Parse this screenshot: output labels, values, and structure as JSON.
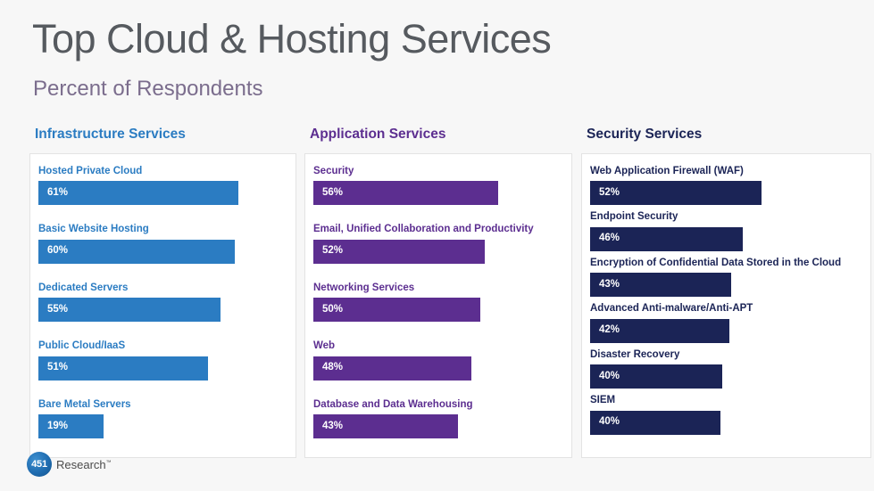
{
  "header": {
    "title": "Top Cloud & Hosting Services",
    "subtitle": "Percent of Respondents"
  },
  "logo": {
    "mark": "451",
    "text": "Research",
    "trademark": "™"
  },
  "colors": {
    "background": "#f7f7f7",
    "panel": "#ffffff",
    "panel_border": "#e3e3e3",
    "title": "#565a5f",
    "subtitle": "#7b6d8d",
    "infrastructure": "#2b7cc2",
    "application": "#5c2e90",
    "security": "#1b2456",
    "value_text": "#ffffff"
  },
  "chart_data": {
    "type": "bar",
    "title": "Top Cloud & Hosting Services",
    "subtitle": "Percent of Respondents",
    "xlabel": "",
    "ylabel": "Percent of Respondents",
    "xlim": [
      0,
      100
    ],
    "grid": false,
    "legend": "none",
    "orientation": "horizontal",
    "value_suffix": "%",
    "groups": [
      {
        "name": "Infrastructure Services",
        "color": "#2b7cc2",
        "categories": [
          "Hosted Private Cloud",
          "Basic Website Hosting",
          "Dedicated Servers",
          "Public Cloud/IaaS",
          "Bare Metal Servers"
        ],
        "values": [
          61,
          60,
          55,
          51,
          19
        ],
        "value_labels": [
          "61%",
          "60%",
          "55%",
          "51%",
          "19%"
        ]
      },
      {
        "name": "Application Services",
        "color": "#5c2e90",
        "categories": [
          "Security",
          "Email, Unified Collaboration and Productivity",
          "Networking Services",
          "Web",
          "Database and Data Warehousing"
        ],
        "values": [
          56,
          52,
          50,
          48,
          43
        ],
        "value_labels": [
          "56%",
          "52%",
          "50%",
          "48%",
          "43%"
        ]
      },
      {
        "name": "Security Services",
        "color": "#1b2456",
        "categories": [
          "Web Application Firewall (WAF)",
          "Endpoint Security",
          "Encryption of Confidential Data Stored in the Cloud",
          "Advanced Anti-malware/Anti-APT",
          "Disaster Recovery",
          "SIEM"
        ],
        "values": [
          52,
          46,
          43,
          42,
          40,
          40
        ],
        "value_labels": [
          "52%",
          "46%",
          "43%",
          "42%",
          "40%",
          "40%"
        ]
      }
    ]
  }
}
